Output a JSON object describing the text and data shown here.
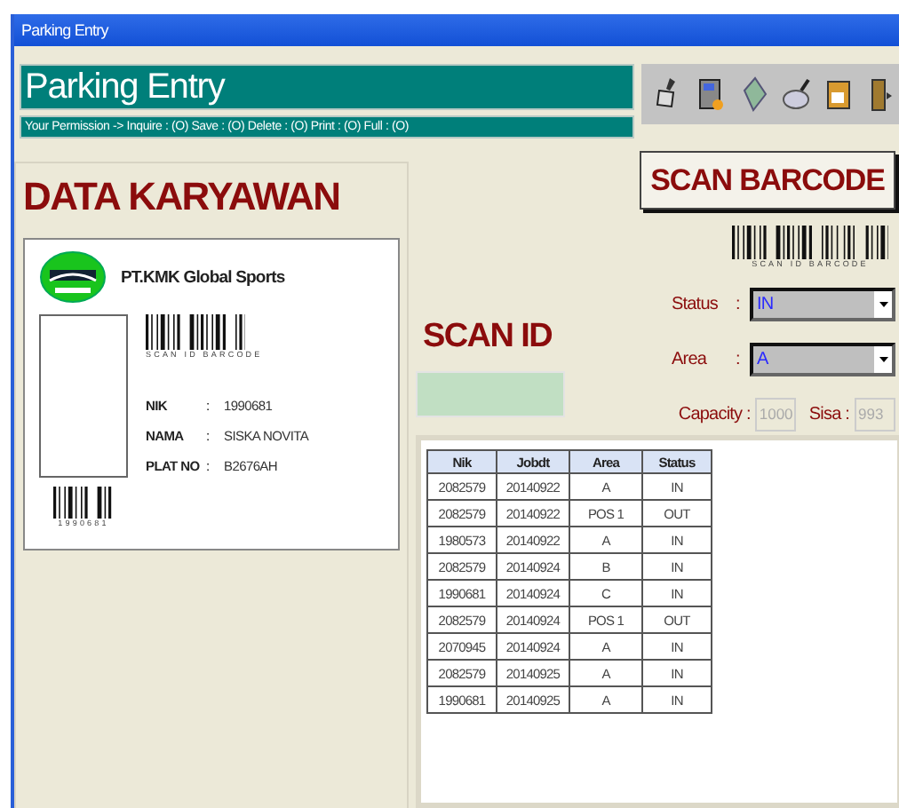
{
  "window": {
    "title": "Parking Entry"
  },
  "header": {
    "title": "Parking Entry",
    "permission": "Your Permission -> Inquire : (O) Save : (O) Delete : (O) Print : (O) Full : (O)"
  },
  "toolbar": [
    {
      "kind": "brush"
    },
    {
      "kind": "machine"
    },
    {
      "kind": "document"
    },
    {
      "kind": "search"
    },
    {
      "kind": "box"
    },
    {
      "kind": "door"
    }
  ],
  "employee": {
    "heading": "DATA KARYAWAN",
    "company": "PT.KMK Global Sports",
    "barcode_caption": "SCAN ID BARCODE",
    "barcode_number": "1990681",
    "fields": [
      {
        "label": "NIK",
        "separator": ":",
        "value": "1990681"
      },
      {
        "label": "NAMA",
        "separator": ":",
        "value": "SISKA NOVITA"
      },
      {
        "label": "PLAT NO",
        "separator": ":",
        "value": "B2676AH"
      }
    ]
  },
  "scan": {
    "button": "SCAN BARCODE",
    "barcode_caption": "SCAN ID BARCODE",
    "heading": "SCAN ID",
    "status": {
      "label": "Status",
      "separator": ":",
      "value": "IN"
    },
    "area": {
      "label": "Area",
      "separator": ":",
      "value": "A"
    },
    "capacity": {
      "label": "Capacity :",
      "value": "1000",
      "disabled": true
    },
    "sisa": {
      "label": "Sisa :",
      "value": "993",
      "disabled": true
    }
  },
  "table": {
    "columns": [
      "Nik",
      "Jobdt",
      "Area",
      "Status"
    ],
    "rows": [
      [
        "2082579",
        "20140922",
        "A",
        "IN"
      ],
      [
        "2082579",
        "20140922",
        "POS 1",
        "OUT"
      ],
      [
        "1980573",
        "20140922",
        "A",
        "IN"
      ],
      [
        "2082579",
        "20140924",
        "B",
        "IN"
      ],
      [
        "1990681",
        "20140924",
        "C",
        "IN"
      ],
      [
        "2082579",
        "20140924",
        "POS 1",
        "OUT"
      ],
      [
        "2070945",
        "20140924",
        "A",
        "IN"
      ],
      [
        "2082579",
        "20140925",
        "A",
        "IN"
      ],
      [
        "1990681",
        "20140925",
        "A",
        "IN"
      ]
    ]
  }
}
